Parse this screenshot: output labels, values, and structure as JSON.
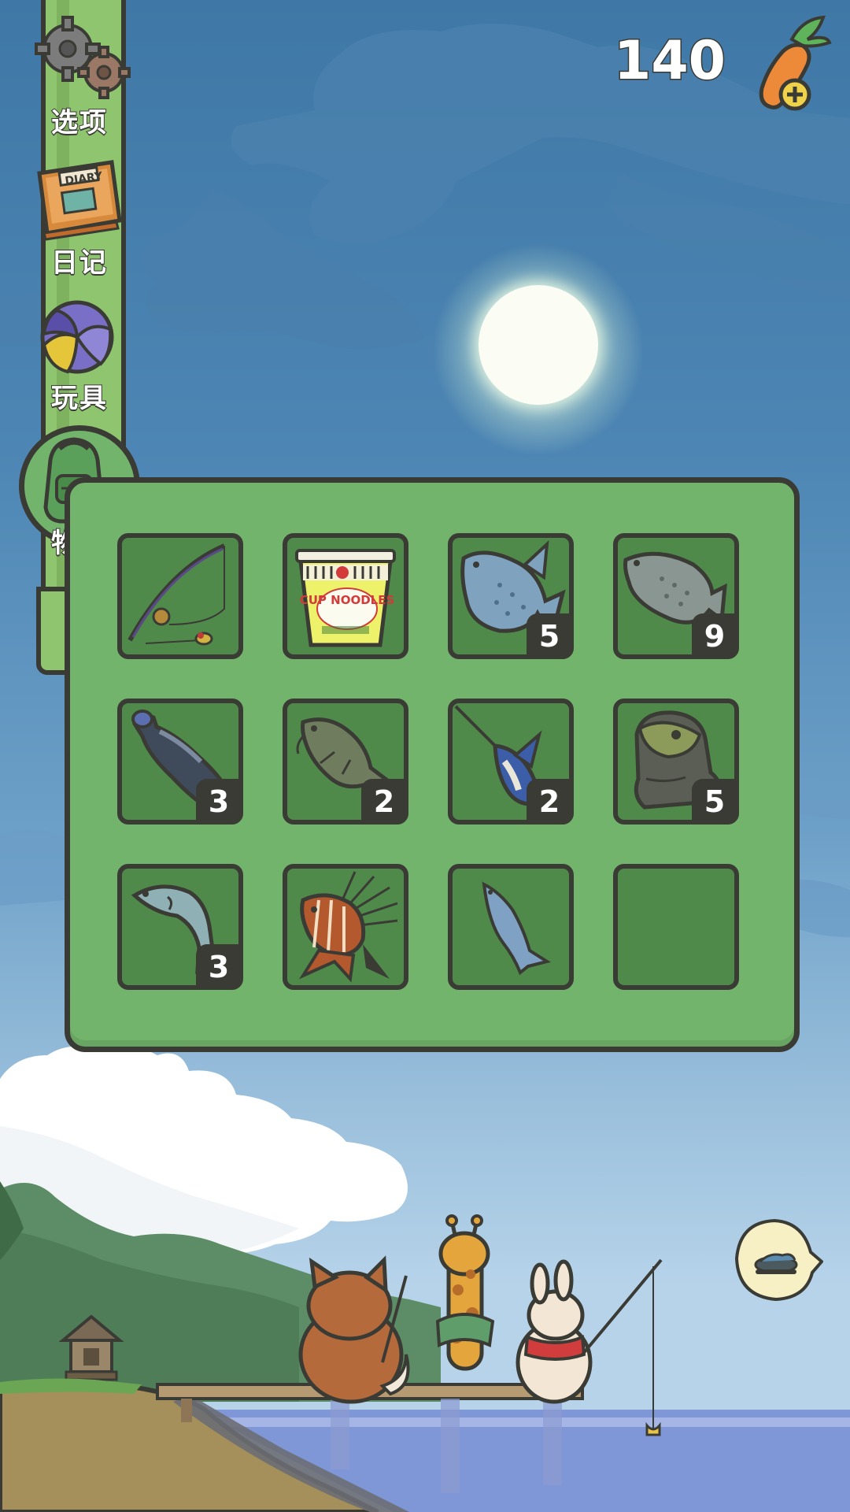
{
  "currency": {
    "carrots": "140",
    "add_icon": "carrot-plus-icon"
  },
  "menu": {
    "items": [
      {
        "label": "选项",
        "icon": "gear-icon"
      },
      {
        "label": "日记",
        "icon": "diary-icon"
      },
      {
        "label": "玩具",
        "icon": "toy-ball-icon"
      },
      {
        "label": "物品",
        "icon": "backpack-icon"
      }
    ]
  },
  "inventory": {
    "slots": [
      {
        "icon": "fishing-rod-icon",
        "count": ""
      },
      {
        "icon": "cup-noodles-icon",
        "label": "CUP NOODLES",
        "count": ""
      },
      {
        "icon": "blue-fish-icon",
        "count": "5"
      },
      {
        "icon": "grey-fish-icon",
        "count": "9"
      },
      {
        "icon": "plastic-bottle-icon",
        "count": "3"
      },
      {
        "icon": "catfish-icon",
        "count": "2"
      },
      {
        "icon": "swordfish-icon",
        "count": "2"
      },
      {
        "icon": "old-boot-icon",
        "count": "5"
      },
      {
        "icon": "mackerel-icon",
        "count": "3"
      },
      {
        "icon": "lionfish-icon",
        "count": ""
      },
      {
        "icon": "small-fish-icon",
        "count": ""
      },
      {
        "icon": "empty-slot",
        "count": ""
      }
    ]
  },
  "feed_button": {
    "icon": "feed-bowl-icon"
  },
  "colors": {
    "panel": "#72b46b",
    "slot": "#4f8a4a",
    "outline": "#3b3b35",
    "sky_top": "#3f78a6",
    "water": "#7f97d6"
  }
}
